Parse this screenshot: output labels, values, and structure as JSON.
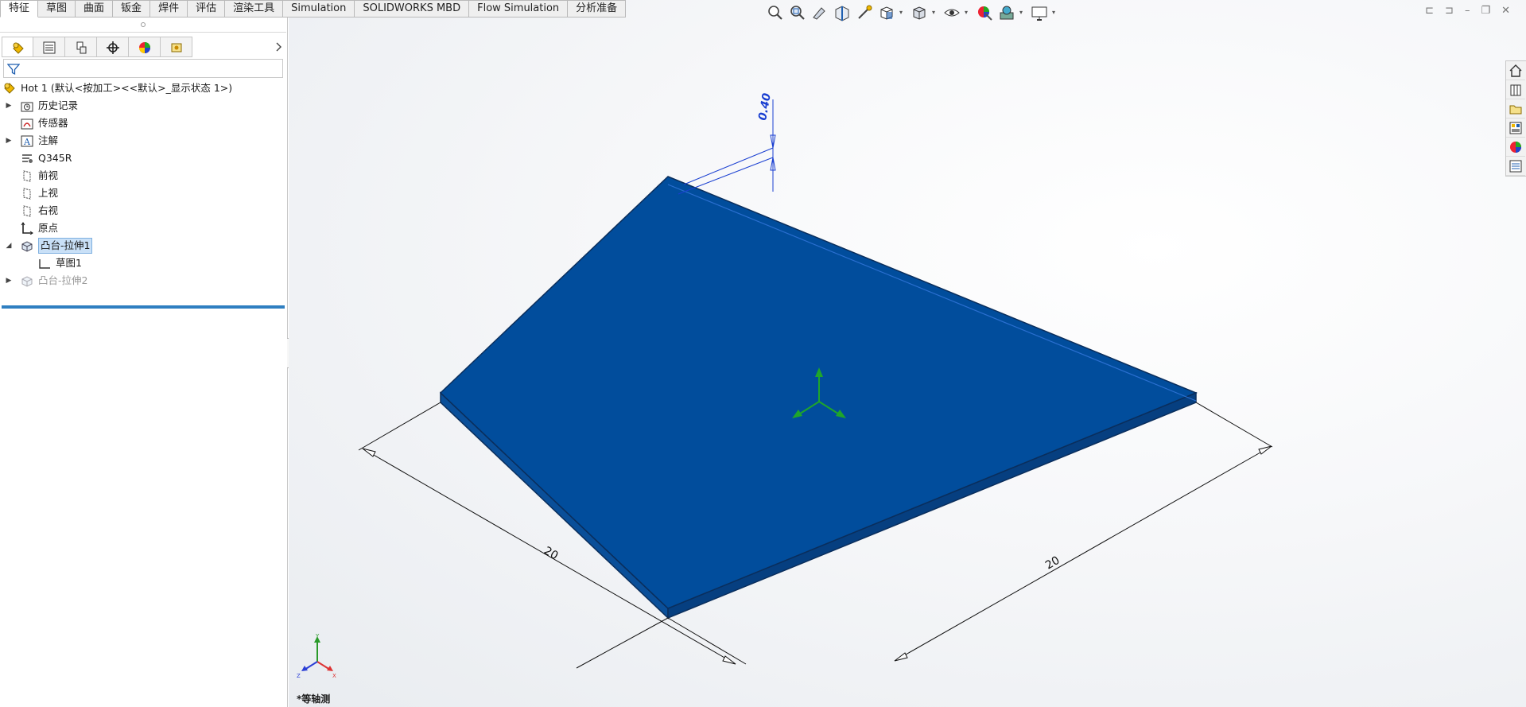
{
  "tabs": [
    {
      "label": "特征",
      "active": true
    },
    {
      "label": "草图"
    },
    {
      "label": "曲面"
    },
    {
      "label": "钣金"
    },
    {
      "label": "焊件"
    },
    {
      "label": "评估"
    },
    {
      "label": "渲染工具"
    },
    {
      "label": "Simulation"
    },
    {
      "label": "SOLIDWORKS MBD"
    },
    {
      "label": "Flow Simulation"
    },
    {
      "label": "分析准备"
    }
  ],
  "feature_tree": {
    "root": "Hot 1  (默认<按加工><<默认>_显示状态 1>)",
    "items": [
      {
        "label": "历史记录",
        "icon": "history-folder-icon",
        "expandable": true
      },
      {
        "label": "传感器",
        "icon": "sensor-icon"
      },
      {
        "label": "注解",
        "icon": "annotation-icon",
        "expandable": true
      },
      {
        "label": "Q345R",
        "icon": "material-icon"
      },
      {
        "label": "前视",
        "icon": "plane-icon"
      },
      {
        "label": "上视",
        "icon": "plane-icon"
      },
      {
        "label": "右视",
        "icon": "plane-icon"
      },
      {
        "label": "原点",
        "icon": "origin-icon"
      },
      {
        "label": "凸台-拉伸1",
        "icon": "extrude-icon",
        "expanded": true,
        "selected": true
      },
      {
        "label": "草图1",
        "icon": "sketch-icon",
        "child": true
      },
      {
        "label": "凸台-拉伸2",
        "icon": "extrude-icon",
        "expandable": true,
        "suppressed": true
      }
    ]
  },
  "model": {
    "dim_thickness": "0.40",
    "dim_left": "20",
    "dim_right": "20",
    "face_color": "#014d9c",
    "edge_color": "#0a2e5c"
  },
  "view_label": "*等轴测",
  "triad_axes": {
    "x": "X",
    "y": "Y",
    "z": "Z"
  }
}
